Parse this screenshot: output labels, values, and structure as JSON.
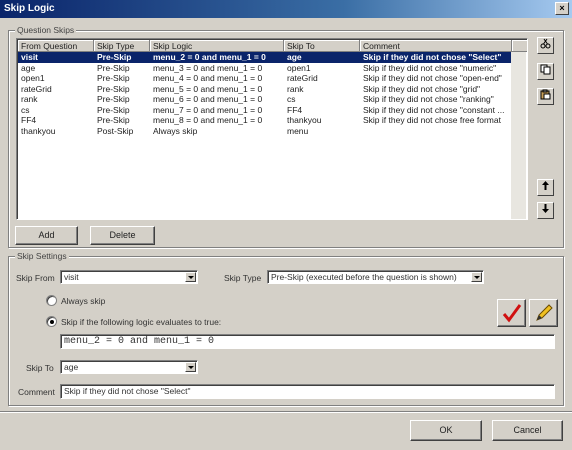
{
  "window": {
    "title": "Skip Logic",
    "close_glyph": "×"
  },
  "question_skips": {
    "group_label": "Question Skips",
    "columns": [
      "From Question",
      "Skip Type",
      "Skip Logic",
      "Skip To",
      "Comment"
    ],
    "rows": [
      [
        "visit",
        "Pre-Skip",
        "menu_2 = 0 and menu_1 = 0",
        "age",
        "Skip if they did not chose \"Select\""
      ],
      [
        "age",
        "Pre-Skip",
        "menu_3 = 0 and menu_1 = 0",
        "open1",
        "Skip if they did not chose \"numeric\""
      ],
      [
        "open1",
        "Pre-Skip",
        "menu_4 = 0 and menu_1 = 0",
        "rateGrid",
        "Skip if they did not chose \"open-end\""
      ],
      [
        "rateGrid",
        "Pre-Skip",
        "menu_5 = 0 and menu_1 = 0",
        "rank",
        "Skip if they did not chose \"grid\""
      ],
      [
        "rank",
        "Pre-Skip",
        "menu_6 = 0 and menu_1 = 0",
        "cs",
        "Skip if they did not chose \"ranking\""
      ],
      [
        "cs",
        "Pre-Skip",
        "menu_7 = 0 and menu_1 = 0",
        "FF4",
        "Skip if they did not chose \"constant ..."
      ],
      [
        "FF4",
        "Pre-Skip",
        "menu_8 = 0 and menu_1 = 0",
        "thankyou",
        "Skip if they did not chose free format"
      ],
      [
        "thankyou",
        "Post-Skip",
        "Always skip",
        "menu",
        ""
      ]
    ],
    "selected_row": 0,
    "add_label": "Add",
    "delete_label": "Delete"
  },
  "side_icons": [
    "scissors-icon",
    "copy-icon",
    "paste-icon",
    "move-up-icon",
    "move-down-icon"
  ],
  "skip_settings": {
    "group_label": "Skip Settings",
    "skip_from_label": "Skip From",
    "skip_from_value": "visit",
    "skip_type_label": "Skip Type",
    "skip_type_value": "Pre-Skip (executed before the question is shown)",
    "always_skip_label": "Always skip",
    "logic_label": "Skip if the following logic evaluates to true:",
    "logic_value": "menu_2 = 0 and menu_1 = 0",
    "skip_to_label": "Skip To",
    "skip_to_value": "age",
    "comment_label": "Comment",
    "comment_value": "Skip if they did not chose \"Select\""
  },
  "footer": {
    "ok_label": "OK",
    "cancel_label": "Cancel"
  },
  "colors": {
    "title_bar": "#0a246a",
    "selection": "#0a246a",
    "check_red": "#d01010",
    "pencil_yellow": "#f0c020"
  }
}
